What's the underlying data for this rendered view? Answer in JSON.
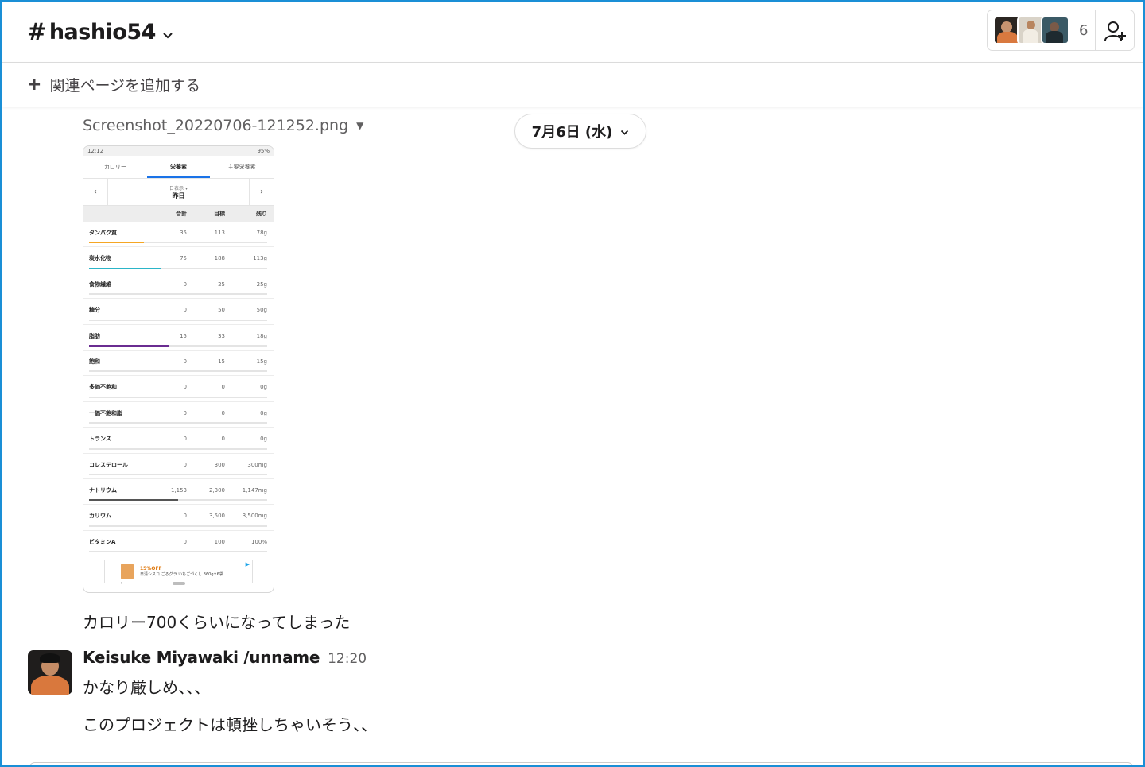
{
  "header": {
    "channel_name": "hashio54",
    "member_count": "6"
  },
  "bookmarks": {
    "add_page_label": "関連ページを追加する"
  },
  "date_divider": {
    "label": "7月6日 (水)"
  },
  "attachment": {
    "filename": "Screenshot_20220706-121252.png",
    "phone": {
      "status_time": "12:12",
      "status_battery": "95%",
      "tabs": [
        "カロリー",
        "栄養素",
        "主要栄養素"
      ],
      "active_tab": 1,
      "nav_small": "日表示 ▾",
      "nav_big": "昨日",
      "columns": [
        "",
        "合計",
        "目標",
        "残り"
      ],
      "rows": [
        {
          "name": "タンパク質",
          "total": "35",
          "goal": "113",
          "left": "78g",
          "progress": 0.31,
          "color": "#f5a623"
        },
        {
          "name": "炭水化物",
          "total": "75",
          "goal": "188",
          "left": "113g",
          "progress": 0.4,
          "color": "#2bb5c8"
        },
        {
          "name": "食物繊維",
          "total": "0",
          "goal": "25",
          "left": "25g",
          "progress": 0,
          "color": "#888888"
        },
        {
          "name": "糖分",
          "total": "0",
          "goal": "50",
          "left": "50g",
          "progress": 0,
          "color": "#888888"
        },
        {
          "name": "脂肪",
          "total": "15",
          "goal": "33",
          "left": "18g",
          "progress": 0.45,
          "color": "#6a2c91"
        },
        {
          "name": "飽和",
          "total": "0",
          "goal": "15",
          "left": "15g",
          "progress": 0,
          "color": "#888888"
        },
        {
          "name": "多価不飽和",
          "total": "0",
          "goal": "0",
          "left": "0g",
          "progress": 0,
          "color": "#888888"
        },
        {
          "name": "一価不飽和脂",
          "total": "0",
          "goal": "0",
          "left": "0g",
          "progress": 0,
          "color": "#888888"
        },
        {
          "name": "トランス",
          "total": "0",
          "goal": "0",
          "left": "0g",
          "progress": 0,
          "color": "#888888"
        },
        {
          "name": "コレステロール",
          "total": "0",
          "goal": "300",
          "left": "300mg",
          "progress": 0,
          "color": "#888888"
        },
        {
          "name": "ナトリウム",
          "total": "1,153",
          "goal": "2,300",
          "left": "1,147mg",
          "progress": 0.5,
          "color": "#555555"
        },
        {
          "name": "カリウム",
          "total": "0",
          "goal": "3,500",
          "left": "3,500mg",
          "progress": 0,
          "color": "#888888"
        },
        {
          "name": "ビタミンA",
          "total": "0",
          "goal": "100",
          "left": "100%",
          "progress": 0,
          "color": "#888888"
        }
      ],
      "ad_offer": "15%OFF",
      "ad_text": "日清シスコ ごろグラ いちごづくし 360g×6袋"
    }
  },
  "messages": [
    {
      "text": "カロリー700くらいになってしまった"
    },
    {
      "sender": "Keisuke Miyawaki /unname",
      "time": "12:20",
      "lines": [
        "かなり厳しめ、、、",
        "このプロジェクトは頓挫しちゃいそう、、"
      ]
    }
  ]
}
